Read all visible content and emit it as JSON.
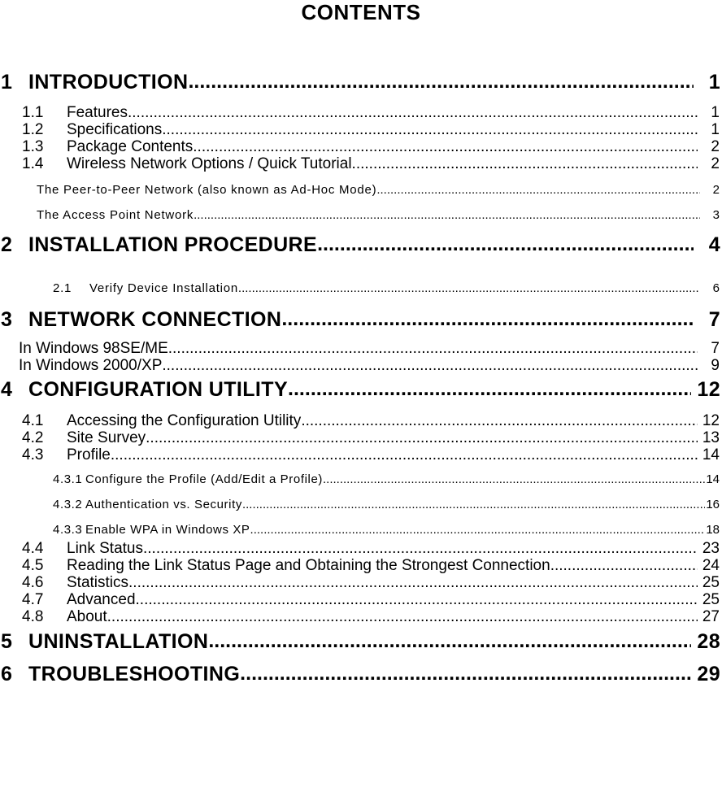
{
  "document": {
    "title": "CONTENTS"
  },
  "toc": {
    "entries": [
      {
        "level": 1,
        "number": "1",
        "label": "INTRODUCTION",
        "page": "1"
      },
      {
        "level": 2,
        "number": "1.1",
        "label": "Features",
        "page": "1"
      },
      {
        "level": 2,
        "number": "1.2",
        "label": "Specifications",
        "page": "1"
      },
      {
        "level": 2,
        "number": "1.3",
        "label": "Package Contents ",
        "page": "2"
      },
      {
        "level": 2,
        "number": "1.4",
        "label": "Wireless Network Options / Quick Tutorial",
        "page": "2"
      },
      {
        "level": 3,
        "number": "",
        "label": "The Peer-to-Peer Network (also known as Ad-Hoc Mode)",
        "page": "2"
      },
      {
        "level": 3,
        "number": "",
        "label": "The Access Point Network ",
        "page": "3"
      },
      {
        "level": 1,
        "number": "2",
        "label": "INSTALLATION PROCEDURE",
        "page": "4"
      },
      {
        "level": 3,
        "number": "2.1",
        "label": "Verify Device Installation",
        "page": "6"
      },
      {
        "level": 1,
        "number": "3",
        "label": "NETWORK CONNECTION",
        "page": "7"
      },
      {
        "level": 2,
        "number": "",
        "label": "In Windows 98SE/ME ",
        "page": "7"
      },
      {
        "level": 2,
        "number": "",
        "label": "In Windows 2000/XP",
        "page": "9"
      },
      {
        "level": 1,
        "number": "4",
        "label": "CONFIGURATION UTILITY ",
        "page": "12"
      },
      {
        "level": 2,
        "number": "4.1",
        "label": "Accessing the Configuration Utility",
        "page": "12"
      },
      {
        "level": 2,
        "number": "4.2",
        "label": "Site Survey ",
        "page": "13"
      },
      {
        "level": 2,
        "number": "4.3",
        "label": "Profile",
        "page": "14"
      },
      {
        "level": 3,
        "number": "4.3.1",
        "label": "Configure the Profile (Add/Edit a Profile)",
        "page": "14"
      },
      {
        "level": 3,
        "number": "4.3.2",
        "label": "Authentication vs. Security ",
        "page": "16"
      },
      {
        "level": 3,
        "number": "4.3.3",
        "label": "Enable WPA in Windows XP",
        "page": "18"
      },
      {
        "level": 2,
        "number": "4.4",
        "label": "Link Status ",
        "page": "23"
      },
      {
        "level": 2,
        "number": "4.5",
        "label": "Reading the Link Status Page and Obtaining the Strongest Connection",
        "page": "24"
      },
      {
        "level": 2,
        "number": "4.6",
        "label": "Statistics",
        "page": "25"
      },
      {
        "level": 2,
        "number": "4.7",
        "label": "Advanced",
        "page": "25"
      },
      {
        "level": 2,
        "number": "4.8",
        "label": "About ",
        "page": "27"
      },
      {
        "level": 1,
        "number": "5",
        "label": "UNINSTALLATION ",
        "page": "28"
      },
      {
        "level": 1,
        "number": "6",
        "label": "TROUBLESHOOTING",
        "page": "29"
      }
    ]
  }
}
